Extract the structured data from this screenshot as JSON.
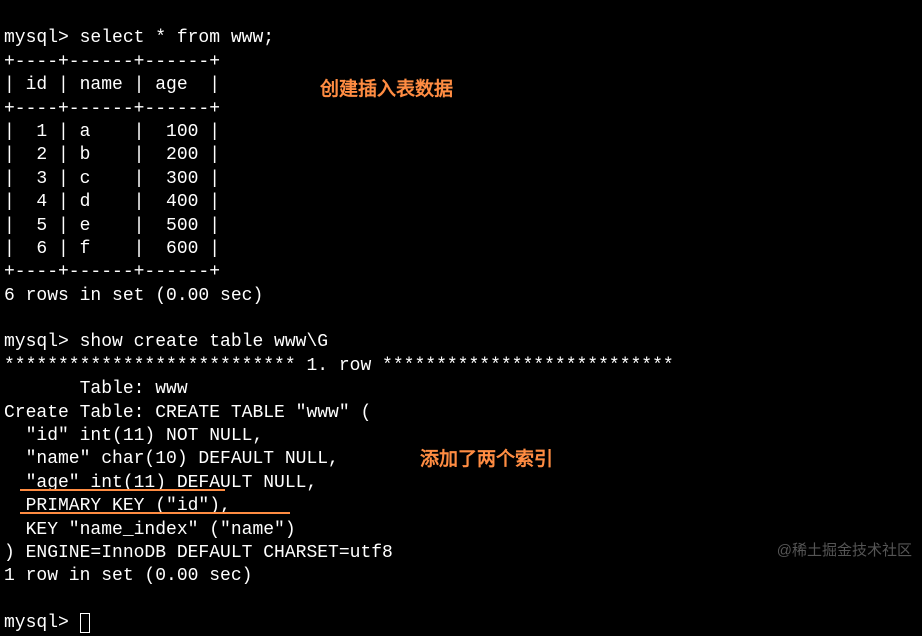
{
  "prompt1": "mysql> select * from www;",
  "table_border_top": "+----+------+------+",
  "table_header": "| id | name | age  |",
  "table_border_mid": "+----+------+------+",
  "table_rows": [
    "|  1 | a    |  100 |",
    "|  2 | b    |  200 |",
    "|  3 | c    |  300 |",
    "|  4 | d    |  400 |",
    "|  5 | e    |  500 |",
    "|  6 | f    |  600 |"
  ],
  "table_border_bot": "+----+------+------+",
  "result1": "6 rows in set (0.00 sec)",
  "blank": "",
  "prompt2": "mysql> show create table www\\G",
  "row_sep": "*************************** 1. row ***************************",
  "table_name": "       Table: www",
  "create_table": "Create Table: CREATE TABLE \"www\" (",
  "col_id": "  \"id\" int(11) NOT NULL,",
  "col_name": "  \"name\" char(10) DEFAULT NULL,",
  "col_age": "  \"age\" int(11) DEFAULT NULL,",
  "pk": "  PRIMARY KEY (\"id\"),",
  "key_index": "  KEY \"name_index\" (\"name\")",
  "engine": ") ENGINE=InnoDB DEFAULT CHARSET=utf8",
  "result2": "1 row in set (0.00 sec)",
  "prompt3": "mysql> ",
  "annotation1": "创建插入表数据",
  "annotation2": "添加了两个索引",
  "watermark": "@稀土掘金技术社区"
}
